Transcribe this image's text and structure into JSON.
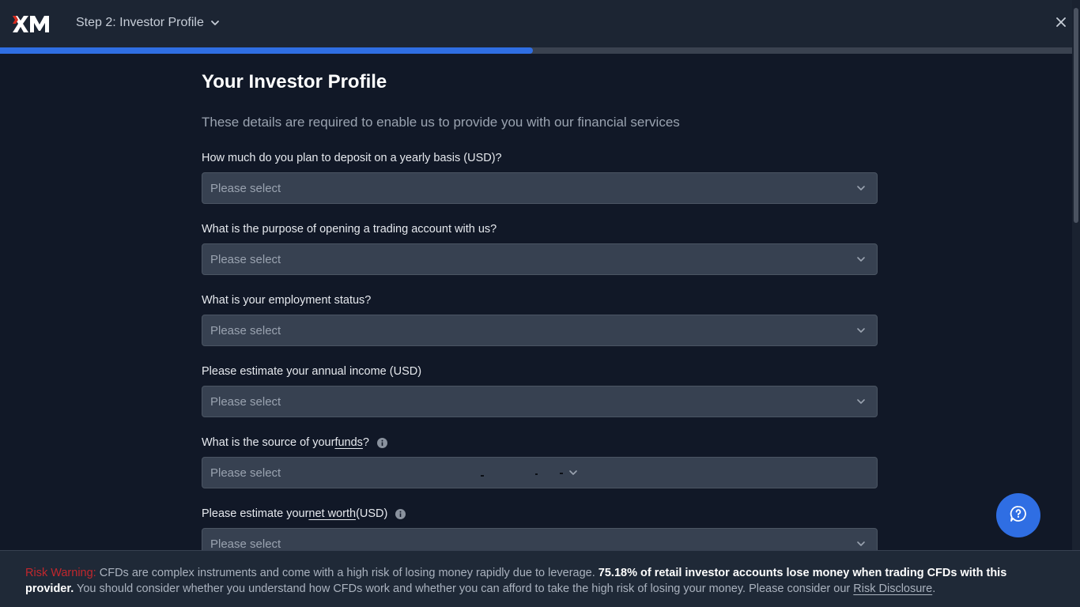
{
  "header": {
    "logo_text": "XM",
    "step_label": "Step 2: Investor Profile",
    "step_icon": "chevron-down-icon",
    "close_icon": "close-icon"
  },
  "progress": {
    "fraction": 0.497
  },
  "main": {
    "title": "Your Investor Profile",
    "subtitle": "These details are required to enable us to provide you with our financial services",
    "fields": [
      {
        "label": "How much do you plan to deposit on a yearly basis (USD)?",
        "placeholder": "Please select"
      },
      {
        "label": "What is the purpose of opening a trading account with us?",
        "placeholder": "Please select"
      },
      {
        "label": "What is your employment status?",
        "placeholder": "Please select"
      },
      {
        "label": "Please estimate your annual income (USD)",
        "placeholder": "Please select"
      },
      {
        "label_before": "What is the source of your ",
        "label_link": "funds",
        "label_after": "?",
        "info_icon": "info-icon",
        "placeholder": "Please select"
      },
      {
        "label_before": "Please estimate your ",
        "label_link": "net worth",
        "label_after": " (USD)",
        "info_icon": "info-icon",
        "placeholder": "Please select"
      }
    ]
  },
  "chat": {
    "icon": "chat-help-icon"
  },
  "risk_warning": {
    "label": "Risk Warning:",
    "text1": " CFDs are complex instruments and come with a high risk of losing money rapidly due to leverage. ",
    "bold": "75.18% of retail investor accounts lose money when trading CFDs with this provider.",
    "text2": " You should consider whether you understand how CFDs work and whether you can afford to take the high risk of losing your money. Please consider our ",
    "link": "Risk Disclosure",
    "text3": "."
  },
  "colors": {
    "background": "#111827",
    "header": "#1c2533",
    "accent": "#2f6ee3",
    "select_bg": "#374151",
    "risk_label": "#c1272d"
  }
}
